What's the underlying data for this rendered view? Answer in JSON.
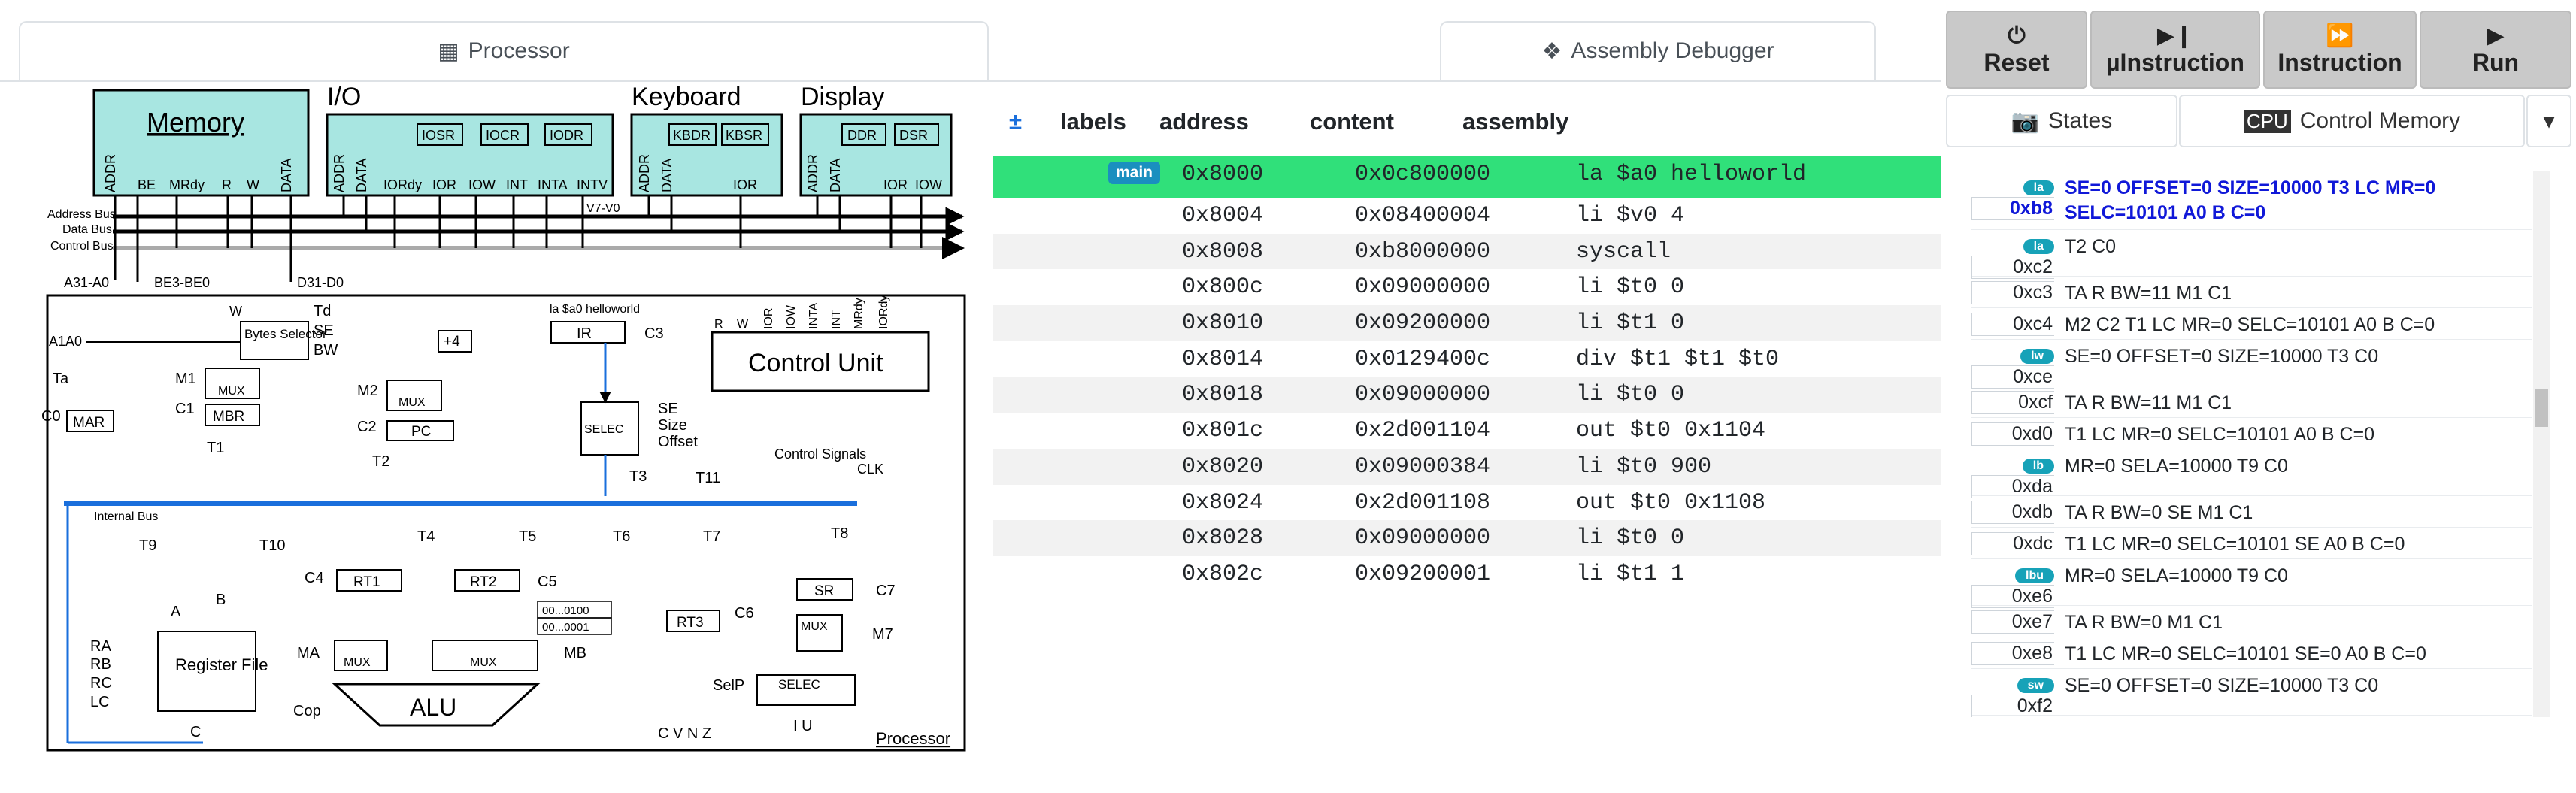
{
  "tabs": {
    "processor": "Processor",
    "debugger": "Assembly Debugger"
  },
  "controls": {
    "reset": "Reset",
    "microinstruction": "µInstruction",
    "instruction": "Instruction",
    "run": "Run",
    "states": "States",
    "control_memory": "Control Memory",
    "cpu_icon_text": "CPU"
  },
  "asm": {
    "headers": {
      "toggle": "±",
      "labels": "labels",
      "address": "address",
      "content": "content",
      "assembly": "assembly"
    },
    "main_label": "main",
    "rows": [
      {
        "address": "0x8000",
        "content": "0x0c800000",
        "assembly": "la $a0 helloworld"
      },
      {
        "address": "0x8004",
        "content": "0x08400004",
        "assembly": "li $v0 4"
      },
      {
        "address": "0x8008",
        "content": "0xb8000000",
        "assembly": "syscall"
      },
      {
        "address": "0x800c",
        "content": "0x09000000",
        "assembly": "li $t0 0"
      },
      {
        "address": "0x8010",
        "content": "0x09200000",
        "assembly": "li $t1 0"
      },
      {
        "address": "0x8014",
        "content": "0x0129400c",
        "assembly": "div $t1 $t1 $t0"
      },
      {
        "address": "0x8018",
        "content": "0x09000000",
        "assembly": "li $t0 0"
      },
      {
        "address": "0x801c",
        "content": "0x2d001104",
        "assembly": "out $t0 0x1104"
      },
      {
        "address": "0x8020",
        "content": "0x09000384",
        "assembly": "li $t0 900"
      },
      {
        "address": "0x8024",
        "content": "0x2d001108",
        "assembly": "out $t0 0x1108"
      },
      {
        "address": "0x8028",
        "content": "0x09000000",
        "assembly": "li $t0 0"
      },
      {
        "address": "0x802c",
        "content": "0x09200001",
        "assembly": "li $t1 1"
      }
    ]
  },
  "control_memory": [
    {
      "tag": "la",
      "addr": "0xb8",
      "text": "SE=0 OFFSET=0 SIZE=10000 T3 LC MR=0 SELC=10101 A0 B C=0",
      "active": true
    },
    {
      "tag": "la",
      "addr": "0xc2",
      "text": "T2 C0"
    },
    {
      "tag": "",
      "addr": "0xc3",
      "text": "TA R BW=11 M1 C1"
    },
    {
      "tag": "",
      "addr": "0xc4",
      "text": "M2 C2 T1 LC MR=0 SELC=10101 A0 B C=0"
    },
    {
      "tag": "lw",
      "addr": "0xce",
      "text": "SE=0 OFFSET=0 SIZE=10000 T3 C0"
    },
    {
      "tag": "",
      "addr": "0xcf",
      "text": "TA R BW=11 M1 C1"
    },
    {
      "tag": "",
      "addr": "0xd0",
      "text": "T1 LC MR=0 SELC=10101 A0 B C=0"
    },
    {
      "tag": "lb",
      "addr": "0xda",
      "text": "MR=0 SELA=10000 T9 C0"
    },
    {
      "tag": "",
      "addr": "0xdb",
      "text": "TA R BW=0 SE M1 C1"
    },
    {
      "tag": "",
      "addr": "0xdc",
      "text": "T1 LC MR=0 SELC=10101 SE A0 B C=0"
    },
    {
      "tag": "lbu",
      "addr": "0xe6",
      "text": "MR=0 SELA=10000 T9 C0"
    },
    {
      "tag": "",
      "addr": "0xe7",
      "text": "TA R BW=0 M1 C1"
    },
    {
      "tag": "",
      "addr": "0xe8",
      "text": "T1 LC MR=0 SELC=10101 SE=0 A0 B C=0"
    },
    {
      "tag": "sw",
      "addr": "0xf2",
      "text": "SE=0 OFFSET=0 SIZE=10000 T3 C0"
    }
  ],
  "diagram": {
    "memory": "Memory",
    "io": "I/O",
    "keyboard": "Keyboard",
    "display": "Display",
    "mem_pins": [
      "ADDR",
      "BE",
      "MRdy",
      "R",
      "W",
      "DATA"
    ],
    "io_regs": [
      "IOSR",
      "IOCR",
      "IODR"
    ],
    "io_pins": [
      "ADDR",
      "DATA",
      "IORdy",
      "IOR",
      "IOW",
      "INT",
      "INTA",
      "INTV"
    ],
    "kb_regs": [
      "KBDR",
      "KBSR"
    ],
    "kb_pins": [
      "ADDR",
      "DATA",
      "IOR"
    ],
    "disp_regs": [
      "DDR",
      "DSR"
    ],
    "disp_pins": [
      "ADDR",
      "DATA",
      "IOR",
      "IOW"
    ],
    "address_bus": "Address Bus",
    "data_bus": "Data Bus",
    "control_bus": "Control Bus",
    "v7": "V7-V0",
    "a31": "A31-A0",
    "be3": "BE3-BE0",
    "d31": "D31-D0",
    "w": "W",
    "td": "Td",
    "bytes_selector": "Bytes Selector",
    "se": "SE",
    "bw": "BW",
    "a1a0": "A1A0",
    "ta": "Ta",
    "m1": "M1",
    "mux": "MUX",
    "c1": "C1",
    "mbr": "MBR",
    "c0": "C0",
    "mar": "MAR",
    "t1": "T1",
    "plus4": "+4",
    "m2": "M2",
    "c2": "C2",
    "pc": "PC",
    "t2": "T2",
    "ir_label": "la $a0 helloworld",
    "ir": "IR",
    "c3": "C3",
    "selec": "SELEC",
    "size": "Size",
    "offset": "Offset",
    "t3": "T3",
    "control_unit": "Control Unit",
    "cu_pins": [
      "R",
      "W",
      "IOR",
      "IOW",
      "INTA",
      "INT",
      "MRdy",
      "IORdy"
    ],
    "t11": "T11",
    "control_signals": "Control Signals",
    "clk": "CLK",
    "internal_bus": "Internal Bus",
    "t9": "T9",
    "t10": "T10",
    "t4": "T4",
    "t5": "T5",
    "t6": "T6",
    "t7": "T7",
    "t8": "T8",
    "c4": "C4",
    "rt1": "RT1",
    "rt2": "RT2",
    "c5": "C5",
    "rt3": "RT3",
    "c6": "C6",
    "sr": "SR",
    "c7": "C7",
    "m7": "M7",
    "a": "A",
    "b": "B",
    "ra": "RA",
    "rb": "RB",
    "rc": "RC",
    "lc": "LC",
    "register_file": "Register File",
    "c": "C",
    "ma": "MA",
    "mb": "MB",
    "k1": "00...0100",
    "k2": "00...0001",
    "alu": "ALU",
    "cop": "Cop",
    "selp": "SelP",
    "flags": "C V N Z",
    "iu": "I   U",
    "processor": "Processor"
  },
  "colors": {
    "accent": "#1a6fdc",
    "debug_row": "#30e07a",
    "badge": "#17a2b8",
    "device": "#a8e6e1",
    "active_text": "#1018d8"
  }
}
